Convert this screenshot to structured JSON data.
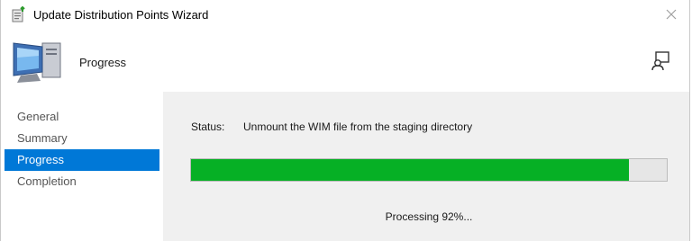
{
  "window": {
    "title": "Update Distribution Points Wizard"
  },
  "header": {
    "title": "Progress"
  },
  "nav": {
    "items": [
      {
        "label": "General",
        "active": false
      },
      {
        "label": "Summary",
        "active": false
      },
      {
        "label": "Progress",
        "active": true
      },
      {
        "label": "Completion",
        "active": false
      }
    ]
  },
  "content": {
    "status_label": "Status:",
    "status_value": "Unmount the WIM file from the staging directory",
    "progress_fraction": 0.92,
    "processing_text": "Processing 92%..."
  },
  "colors": {
    "accent": "#0078d7",
    "progress_fill": "#06b025",
    "content_bg": "#f0f0f0"
  },
  "icons": {
    "title": "wizard-app-icon",
    "close": "close-icon",
    "header": "computer-icon",
    "help": "help-feedback-icon"
  }
}
